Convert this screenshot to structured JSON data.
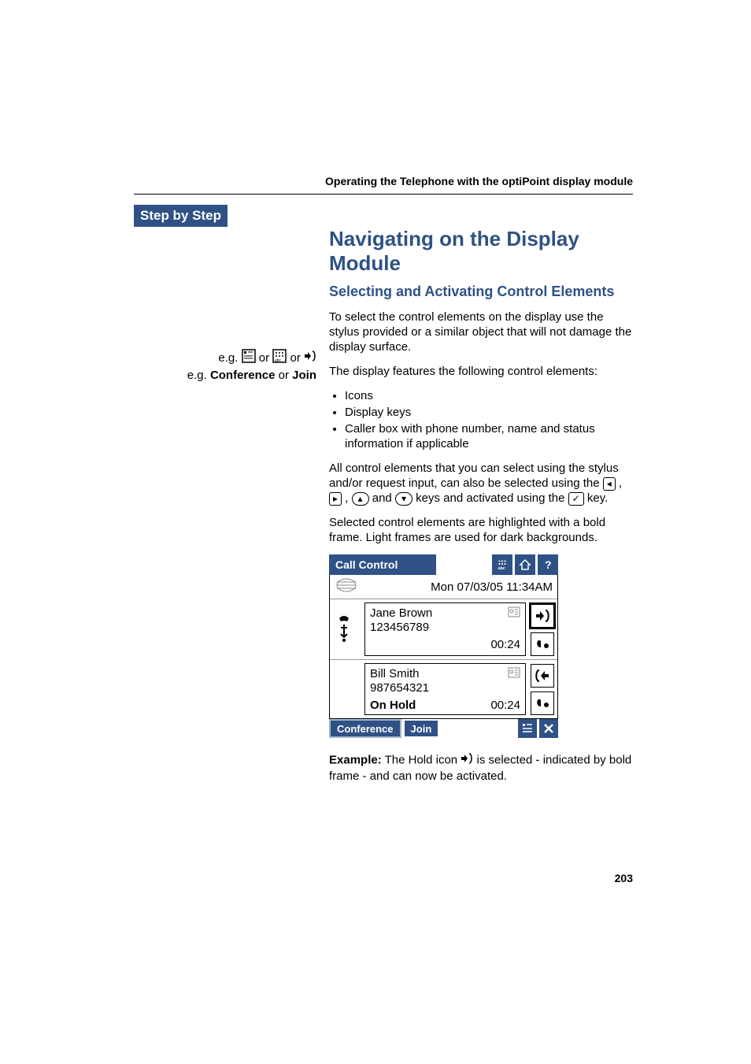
{
  "running_header": "Operating the Telephone with the optiPoint display module",
  "sidebar": {
    "step_label": "Step by Step",
    "eg_prefix": "e.g.",
    "or": "or",
    "eg2_a": "Conference",
    "eg2_b": "Join"
  },
  "main": {
    "title": "Navigating on the Display Module",
    "subtitle": "Selecting and Activating Control Elements",
    "p1": "To select the control elements on the display use the stylus provided or a similar object that will not damage the display surface.",
    "p2": "The display features the following control elements:",
    "li1": "Icons",
    "li2": "Display keys",
    "li3": "Caller box with phone number, name and status information if applicable",
    "p3a": "All control elements that you can select using the stylus and/or request input, can also be selected using the ",
    "p3b": " , ",
    "p3c": " and ",
    "p3d": " keys and activated using the ",
    "p3e": " key.",
    "p4": "Selected control elements are highlighted with a bold frame. Light frames are used for dark backgrounds.",
    "example_label": "Example:",
    "example_a": " The Hold icon ",
    "example_b": " is selected - indicated by bold frame - and can now be activated."
  },
  "display": {
    "header_left": "Call Control",
    "date": "Mon 07/03/05 11:34AM",
    "call1_name": "Jane Brown",
    "call1_number": "123456789",
    "call1_time": "00:24",
    "call2_name": "Bill Smith",
    "call2_number": "987654321",
    "call2_status": "On Hold",
    "call2_time": "00:24",
    "footer_btn1": "Conference",
    "footer_btn2": "Join"
  },
  "page_number": "203"
}
